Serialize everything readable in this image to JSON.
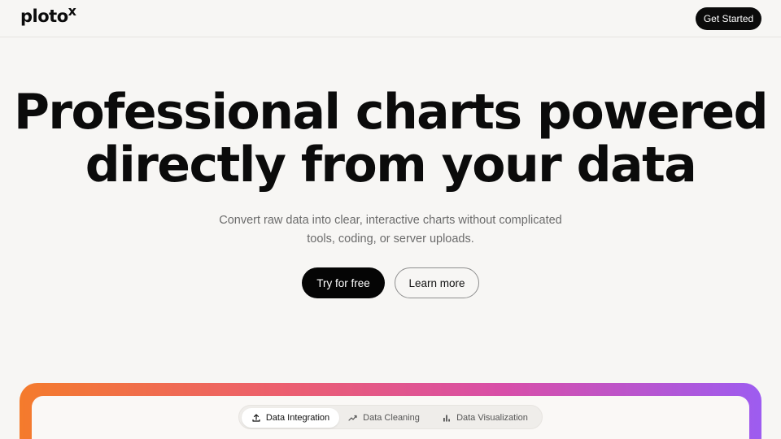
{
  "nav": {
    "logo_text": "ploto",
    "logo_sup": "x",
    "cta_label": "Get Started"
  },
  "hero": {
    "title_line1": "Professional charts powered",
    "title_line2": "directly from your data",
    "subtitle_line1": "Convert raw data into clear, interactive charts without complicated",
    "subtitle_line2": "tools, coding, or server uploads.",
    "primary_button": "Try for free",
    "secondary_button": "Learn more"
  },
  "tabs": [
    {
      "label": "Data Integration",
      "icon": "upload-icon",
      "active": true
    },
    {
      "label": "Data Cleaning",
      "icon": "trend-icon",
      "active": false
    },
    {
      "label": "Data Visualization",
      "icon": "bar-chart-icon",
      "active": false
    }
  ],
  "colors": {
    "gradient": [
      "#f47b2c",
      "#ec5f6e",
      "#d84ea8",
      "#9d5cf0"
    ],
    "primary": "#0b0b0b",
    "background": "#f7f6f4"
  }
}
